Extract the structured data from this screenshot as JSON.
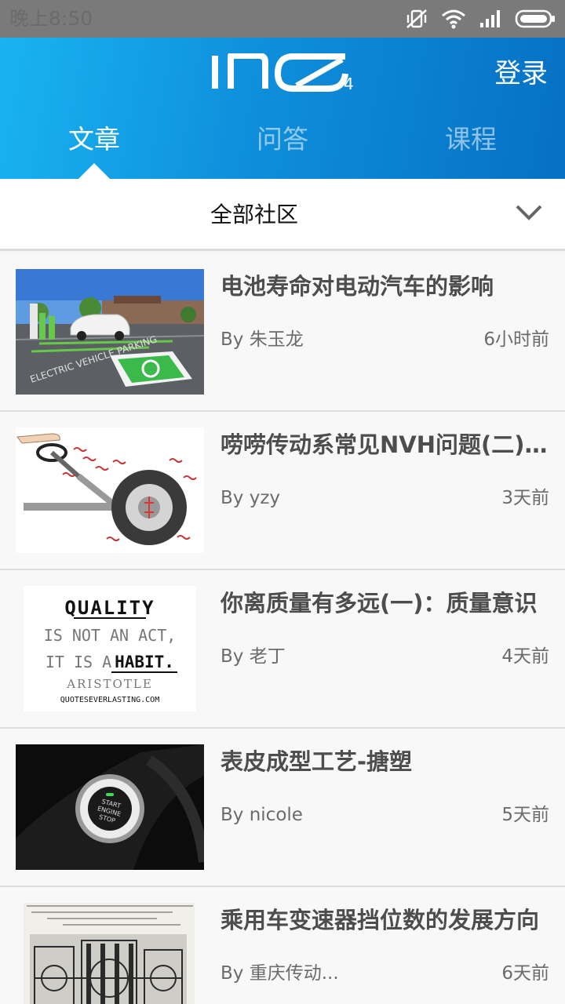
{
  "status_bar": {
    "time": "晚上8:50",
    "icons": [
      "mute-vibrate-icon",
      "wifi-icon",
      "signal-icon",
      "battery-icon"
    ]
  },
  "header": {
    "logo_alt": "INO4",
    "login_label": "登录",
    "tabs": [
      {
        "label": "文章",
        "active": true
      },
      {
        "label": "问答",
        "active": false
      },
      {
        "label": "课程",
        "active": false
      }
    ],
    "colors": {
      "gradient_start": "#19b3f0",
      "gradient_end": "#0670c4"
    }
  },
  "filter": {
    "selected": "全部社区",
    "icon": "chevron-down-icon"
  },
  "articles": [
    {
      "title": "电池寿命对电动汽车的影响",
      "author": "By 朱玉龙",
      "time": "6小时前",
      "thumb": "ev-charging-parking"
    },
    {
      "title": "唠唠传动系常见NVH问题(二) 转向盘抖动",
      "author": "By yzy",
      "time": "3天前",
      "thumb": "steering-wheel-vibration"
    },
    {
      "title": "你离质量有多远(一)：质量意识",
      "author": "By 老丁",
      "time": "4天前",
      "thumb": "quality-quote",
      "thumb_text": [
        "QUALITY",
        "IS NOT AN ACT,",
        "IT IS A",
        "HABIT.",
        "ARISTOTLE",
        "QUOTESEVERLASTING.COM"
      ]
    },
    {
      "title": "表皮成型工艺-搪塑",
      "author": "By nicole",
      "time": "5天前",
      "thumb": "engine-start-button",
      "thumb_text": [
        "START",
        "ENGINE",
        "STOP"
      ]
    },
    {
      "title": "乘用车变速器挡位数的发展方向",
      "author": "By 重庆传动...",
      "time": "6天前",
      "thumb": "transmission-drawing"
    }
  ]
}
